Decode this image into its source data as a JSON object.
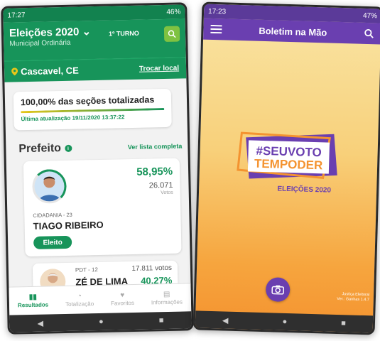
{
  "phone1": {
    "status": {
      "time": "17:27",
      "battery": "46%"
    },
    "header": {
      "title": "Eleições 2020 ⌄",
      "subtitle": "Municipal Ordinária",
      "turno": "1º TURNO"
    },
    "location": {
      "city": "Cascavel, CE",
      "change_label": "Trocar local"
    },
    "sections": {
      "title": "100,00% das seções totalizadas",
      "progress": 1.0,
      "updated": "Última atualização 19/11/2020 13:37:22"
    },
    "prefeito": {
      "label": "Prefeito",
      "see_all": "Ver lista completa"
    },
    "candidate1": {
      "percent": "58,95%",
      "votes": "26.071",
      "votes_label": "Votos",
      "party": "CIDADANIA - 23",
      "name": "TIAGO RIBEIRO",
      "badge": "Eleito"
    },
    "candidate2": {
      "party": "PDT - 12",
      "name": "ZÉ DE LIMA",
      "votes": "17.811 votos",
      "percent": "40,27%"
    },
    "nav": {
      "resultados": "Resultados",
      "totalizacao": "Totalização",
      "favoritos": "Favoritos",
      "informacoes": "Informações"
    }
  },
  "phone2": {
    "status": {
      "time": "17:23",
      "battery": "47%"
    },
    "title": "Boletim na Mão",
    "logo": {
      "line1": "#SEUVOTO",
      "line2": "TEMPODER",
      "line3": "ELEIÇÕES 2020"
    },
    "version": {
      "line1": "Justiça Eleitoral",
      "line2": "Ver.: Ganhas 1.4.7"
    }
  },
  "colors": {
    "green": "#17945a",
    "purple": "#6a3fb0",
    "orange": "#f49330"
  }
}
